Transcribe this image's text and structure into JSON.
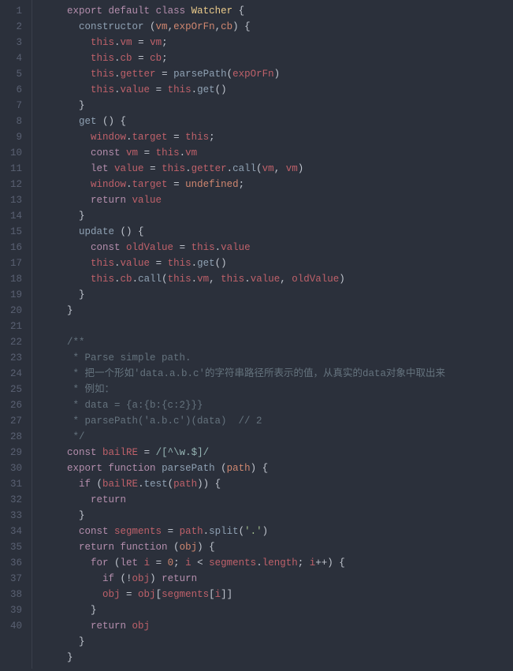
{
  "domain": "Document",
  "language": "javascript",
  "line_count": 40,
  "gutter": [
    "1",
    "2",
    "3",
    "4",
    "5",
    "6",
    "7",
    "8",
    "9",
    "10",
    "11",
    "12",
    "13",
    "14",
    "15",
    "16",
    "17",
    "18",
    "19",
    "20",
    "21",
    "22",
    "23",
    "24",
    "25",
    "26",
    "27",
    "28",
    "29",
    "30",
    "31",
    "32",
    "33",
    "34",
    "35",
    "36",
    "37",
    "38",
    "39",
    "40"
  ],
  "code_lines": [
    {
      "i": "    ",
      "t": [
        [
          "kw",
          "export"
        ],
        [
          "punc",
          " "
        ],
        [
          "kw",
          "default"
        ],
        [
          "punc",
          " "
        ],
        [
          "kw",
          "class"
        ],
        [
          "punc",
          " "
        ],
        [
          "cls",
          "Watcher"
        ],
        [
          "punc",
          " {"
        ]
      ]
    },
    {
      "i": "      ",
      "t": [
        [
          "fn",
          "constructor"
        ],
        [
          "punc",
          " ("
        ],
        [
          "param",
          "vm"
        ],
        [
          "punc",
          ","
        ],
        [
          "param",
          "expOrFn"
        ],
        [
          "punc",
          ","
        ],
        [
          "param",
          "cb"
        ],
        [
          "punc",
          ") {"
        ]
      ]
    },
    {
      "i": "        ",
      "t": [
        [
          "self",
          "this"
        ],
        [
          "punc",
          "."
        ],
        [
          "prop",
          "vm"
        ],
        [
          "punc",
          " = "
        ],
        [
          "prop",
          "vm"
        ],
        [
          "punc",
          ";"
        ]
      ]
    },
    {
      "i": "        ",
      "t": [
        [
          "self",
          "this"
        ],
        [
          "punc",
          "."
        ],
        [
          "prop",
          "cb"
        ],
        [
          "punc",
          " = "
        ],
        [
          "prop",
          "cb"
        ],
        [
          "punc",
          ";"
        ]
      ]
    },
    {
      "i": "        ",
      "t": [
        [
          "self",
          "this"
        ],
        [
          "punc",
          "."
        ],
        [
          "prop",
          "getter"
        ],
        [
          "punc",
          " = "
        ],
        [
          "call",
          "parsePath"
        ],
        [
          "punc",
          "("
        ],
        [
          "prop",
          "expOrFn"
        ],
        [
          "punc",
          ")"
        ]
      ]
    },
    {
      "i": "        ",
      "t": [
        [
          "self",
          "this"
        ],
        [
          "punc",
          "."
        ],
        [
          "prop",
          "value"
        ],
        [
          "punc",
          " = "
        ],
        [
          "self",
          "this"
        ],
        [
          "punc",
          "."
        ],
        [
          "call",
          "get"
        ],
        [
          "punc",
          "()"
        ]
      ]
    },
    {
      "i": "      ",
      "t": [
        [
          "punc",
          "}"
        ]
      ]
    },
    {
      "i": "      ",
      "t": [
        [
          "fn",
          "get"
        ],
        [
          "punc",
          " () {"
        ]
      ]
    },
    {
      "i": "        ",
      "t": [
        [
          "prop",
          "window"
        ],
        [
          "punc",
          "."
        ],
        [
          "prop",
          "target"
        ],
        [
          "punc",
          " = "
        ],
        [
          "self",
          "this"
        ],
        [
          "punc",
          ";"
        ]
      ]
    },
    {
      "i": "        ",
      "t": [
        [
          "kw",
          "const"
        ],
        [
          "punc",
          " "
        ],
        [
          "prop",
          "vm"
        ],
        [
          "punc",
          " = "
        ],
        [
          "self",
          "this"
        ],
        [
          "punc",
          "."
        ],
        [
          "prop",
          "vm"
        ]
      ]
    },
    {
      "i": "        ",
      "t": [
        [
          "kw",
          "let"
        ],
        [
          "punc",
          " "
        ],
        [
          "prop",
          "value"
        ],
        [
          "punc",
          " = "
        ],
        [
          "self",
          "this"
        ],
        [
          "punc",
          "."
        ],
        [
          "prop",
          "getter"
        ],
        [
          "punc",
          "."
        ],
        [
          "call",
          "call"
        ],
        [
          "punc",
          "("
        ],
        [
          "prop",
          "vm"
        ],
        [
          "punc",
          ", "
        ],
        [
          "prop",
          "vm"
        ],
        [
          "punc",
          ")"
        ]
      ]
    },
    {
      "i": "        ",
      "t": [
        [
          "prop",
          "window"
        ],
        [
          "punc",
          "."
        ],
        [
          "prop",
          "target"
        ],
        [
          "punc",
          " = "
        ],
        [
          "param",
          "undefined"
        ],
        [
          "punc",
          ";"
        ]
      ]
    },
    {
      "i": "        ",
      "t": [
        [
          "kw",
          "return"
        ],
        [
          "punc",
          " "
        ],
        [
          "prop",
          "value"
        ]
      ]
    },
    {
      "i": "      ",
      "t": [
        [
          "punc",
          "}"
        ]
      ]
    },
    {
      "i": "      ",
      "t": [
        [
          "fn",
          "update"
        ],
        [
          "punc",
          " () {"
        ]
      ]
    },
    {
      "i": "        ",
      "t": [
        [
          "kw",
          "const"
        ],
        [
          "punc",
          " "
        ],
        [
          "prop",
          "oldValue"
        ],
        [
          "punc",
          " = "
        ],
        [
          "self",
          "this"
        ],
        [
          "punc",
          "."
        ],
        [
          "prop",
          "value"
        ]
      ]
    },
    {
      "i": "        ",
      "t": [
        [
          "self",
          "this"
        ],
        [
          "punc",
          "."
        ],
        [
          "prop",
          "value"
        ],
        [
          "punc",
          " = "
        ],
        [
          "self",
          "this"
        ],
        [
          "punc",
          "."
        ],
        [
          "call",
          "get"
        ],
        [
          "punc",
          "()"
        ]
      ]
    },
    {
      "i": "        ",
      "t": [
        [
          "self",
          "this"
        ],
        [
          "punc",
          "."
        ],
        [
          "prop",
          "cb"
        ],
        [
          "punc",
          "."
        ],
        [
          "call",
          "call"
        ],
        [
          "punc",
          "("
        ],
        [
          "self",
          "this"
        ],
        [
          "punc",
          "."
        ],
        [
          "prop",
          "vm"
        ],
        [
          "punc",
          ", "
        ],
        [
          "self",
          "this"
        ],
        [
          "punc",
          "."
        ],
        [
          "prop",
          "value"
        ],
        [
          "punc",
          ", "
        ],
        [
          "prop",
          "oldValue"
        ],
        [
          "punc",
          ")"
        ]
      ]
    },
    {
      "i": "      ",
      "t": [
        [
          "punc",
          "}"
        ]
      ]
    },
    {
      "i": "    ",
      "t": [
        [
          "punc",
          "}"
        ]
      ]
    },
    {
      "i": "",
      "t": []
    },
    {
      "i": "    ",
      "t": [
        [
          "cm",
          "/**"
        ]
      ]
    },
    {
      "i": "    ",
      "t": [
        [
          "cm",
          " * Parse simple path."
        ]
      ]
    },
    {
      "i": "    ",
      "t": [
        [
          "cm",
          " * 把一个形如'data.a.b.c'的字符串路径所表示的值，从真实的data对象中取出来"
        ]
      ]
    },
    {
      "i": "    ",
      "t": [
        [
          "cm",
          " * 例如："
        ]
      ]
    },
    {
      "i": "    ",
      "t": [
        [
          "cm",
          " * data = {a:{b:{c:2}}}"
        ]
      ]
    },
    {
      "i": "    ",
      "t": [
        [
          "cm",
          " * parsePath('a.b.c')(data)  // 2"
        ]
      ]
    },
    {
      "i": "    ",
      "t": [
        [
          "cm",
          " */"
        ]
      ]
    },
    {
      "i": "    ",
      "t": [
        [
          "kw",
          "const"
        ],
        [
          "punc",
          " "
        ],
        [
          "prop",
          "bailRE"
        ],
        [
          "punc",
          " = "
        ],
        [
          "re",
          "/[^\\w.$]/"
        ]
      ]
    },
    {
      "i": "    ",
      "t": [
        [
          "kw",
          "export"
        ],
        [
          "punc",
          " "
        ],
        [
          "kw",
          "function"
        ],
        [
          "punc",
          " "
        ],
        [
          "fn",
          "parsePath"
        ],
        [
          "punc",
          " ("
        ],
        [
          "param",
          "path"
        ],
        [
          "punc",
          ") {"
        ]
      ]
    },
    {
      "i": "      ",
      "t": [
        [
          "kw",
          "if"
        ],
        [
          "punc",
          " ("
        ],
        [
          "prop",
          "bailRE"
        ],
        [
          "punc",
          "."
        ],
        [
          "call",
          "test"
        ],
        [
          "punc",
          "("
        ],
        [
          "prop",
          "path"
        ],
        [
          "punc",
          ")) {"
        ]
      ]
    },
    {
      "i": "        ",
      "t": [
        [
          "kw",
          "return"
        ]
      ]
    },
    {
      "i": "      ",
      "t": [
        [
          "punc",
          "}"
        ]
      ]
    },
    {
      "i": "      ",
      "t": [
        [
          "kw",
          "const"
        ],
        [
          "punc",
          " "
        ],
        [
          "prop",
          "segments"
        ],
        [
          "punc",
          " = "
        ],
        [
          "prop",
          "path"
        ],
        [
          "punc",
          "."
        ],
        [
          "call",
          "split"
        ],
        [
          "punc",
          "("
        ],
        [
          "str",
          "'.'"
        ],
        [
          "punc",
          ")"
        ]
      ]
    },
    {
      "i": "      ",
      "t": [
        [
          "kw",
          "return"
        ],
        [
          "punc",
          " "
        ],
        [
          "kw",
          "function"
        ],
        [
          "punc",
          " ("
        ],
        [
          "param",
          "obj"
        ],
        [
          "punc",
          ") {"
        ]
      ]
    },
    {
      "i": "        ",
      "t": [
        [
          "kw",
          "for"
        ],
        [
          "punc",
          " ("
        ],
        [
          "kw",
          "let"
        ],
        [
          "punc",
          " "
        ],
        [
          "prop",
          "i"
        ],
        [
          "punc",
          " = "
        ],
        [
          "num",
          "0"
        ],
        [
          "punc",
          "; "
        ],
        [
          "prop",
          "i"
        ],
        [
          "punc",
          " < "
        ],
        [
          "prop",
          "segments"
        ],
        [
          "punc",
          "."
        ],
        [
          "prop",
          "length"
        ],
        [
          "punc",
          "; "
        ],
        [
          "prop",
          "i"
        ],
        [
          "punc",
          "++) {"
        ]
      ]
    },
    {
      "i": "          ",
      "t": [
        [
          "kw",
          "if"
        ],
        [
          "punc",
          " (!"
        ],
        [
          "prop",
          "obj"
        ],
        [
          "punc",
          ") "
        ],
        [
          "kw",
          "return"
        ]
      ]
    },
    {
      "i": "          ",
      "t": [
        [
          "prop",
          "obj"
        ],
        [
          "punc",
          " = "
        ],
        [
          "prop",
          "obj"
        ],
        [
          "punc",
          "["
        ],
        [
          "prop",
          "segments"
        ],
        [
          "punc",
          "["
        ],
        [
          "prop",
          "i"
        ],
        [
          "punc",
          "]]"
        ]
      ]
    },
    {
      "i": "        ",
      "t": [
        [
          "punc",
          "}"
        ]
      ]
    },
    {
      "i": "        ",
      "t": [
        [
          "kw",
          "return"
        ],
        [
          "punc",
          " "
        ],
        [
          "prop",
          "obj"
        ]
      ]
    },
    {
      "i": "      ",
      "t": [
        [
          "punc",
          "}"
        ]
      ]
    },
    {
      "i": "    ",
      "t": [
        [
          "punc",
          "}"
        ]
      ]
    }
  ]
}
